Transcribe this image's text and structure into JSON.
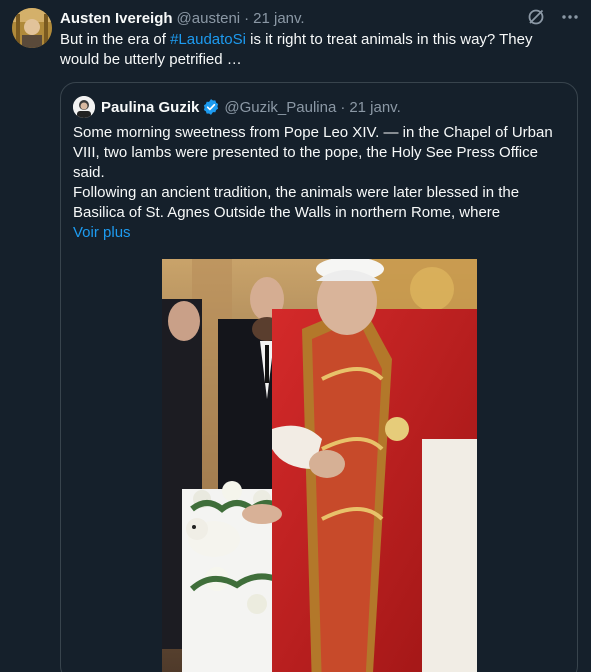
{
  "tweet": {
    "author_name": "Austen Ivereigh",
    "author_handle": "@austeni",
    "separator": "·",
    "date": "21 janv.",
    "text_before": "But in the era of ",
    "hashtag": "#LaudatoSi",
    "text_after": " is it right to treat animals in this way? They would be utterly petrified …",
    "actions": {
      "grok_icon": "grok-icon",
      "more_icon": "more-icon"
    }
  },
  "quote": {
    "author_name": "Paulina Guzik",
    "author_handle": "@Guzik_Paulina",
    "separator": "·",
    "date": "21 janv.",
    "verified": true,
    "paragraph1": "Some morning sweetness from Pope Leo XIV. — in the Chapel of Urban VIII, two lambs were presented to the pope, the Holy See Press Office said.",
    "paragraph2": "Following an ancient tradition, the animals were later blessed in the Basilica of St. Agnes Outside the Walls in northern Rome, where",
    "more_label": "Voir plus"
  },
  "colors": {
    "background": "#15202b",
    "text": "#f7f9f9",
    "secondary": "#8b98a5",
    "link": "#1d9bf0",
    "border": "#38444d"
  }
}
